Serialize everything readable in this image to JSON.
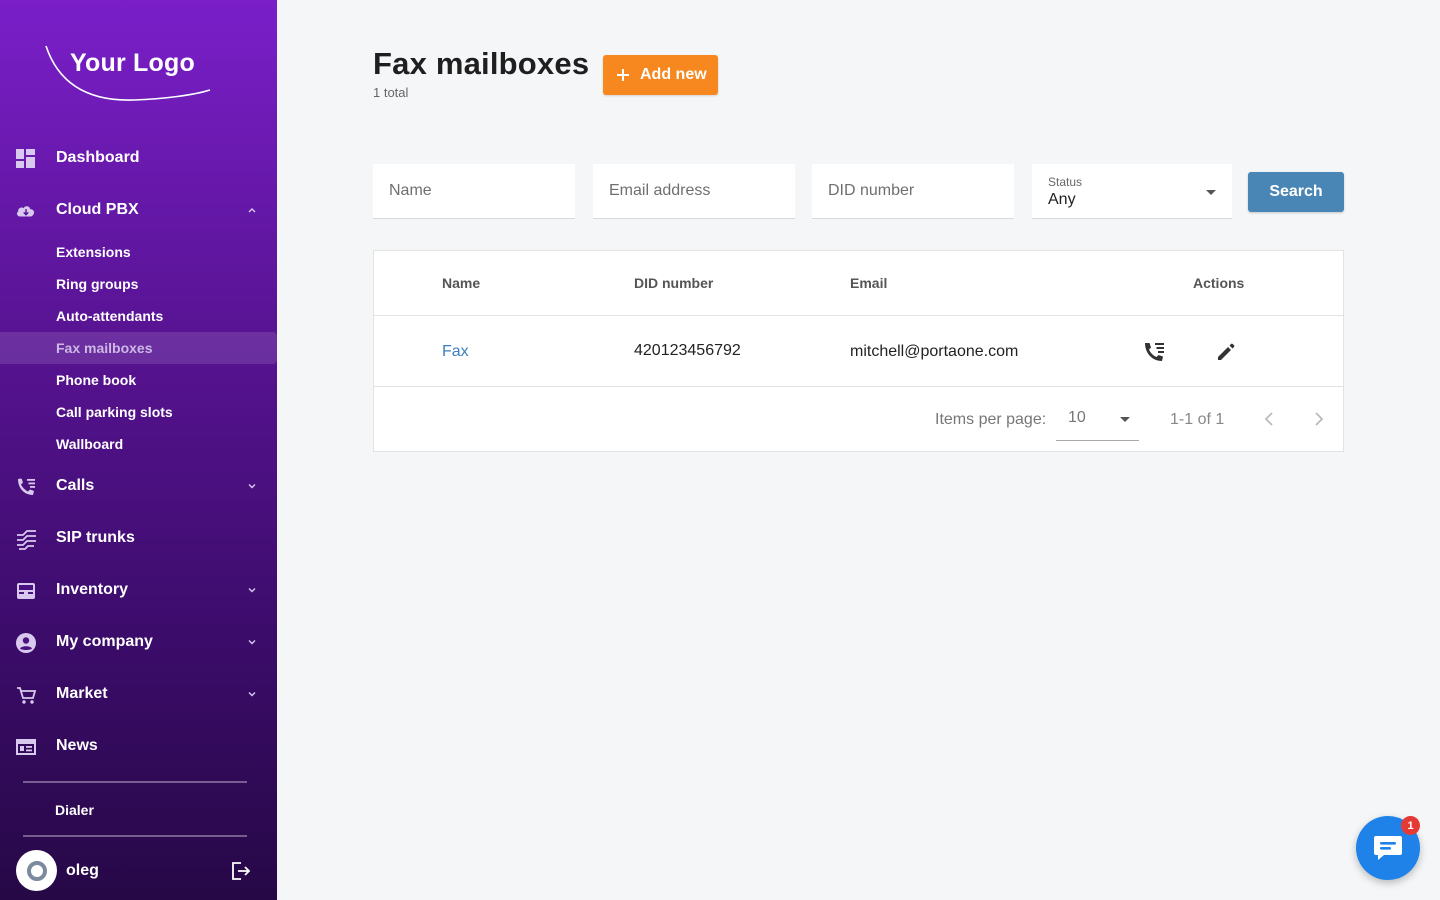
{
  "sidebar": {
    "logo_text": "Your Logo",
    "nav": {
      "dashboard": "Dashboard",
      "cloud_pbx": "Cloud PBX",
      "calls": "Calls",
      "sip_trunks": "SIP trunks",
      "inventory": "Inventory",
      "my_company": "My company",
      "market": "Market",
      "news": "News"
    },
    "cloud_pbx_items": {
      "extensions": "Extensions",
      "ring_groups": "Ring groups",
      "auto_attendants": "Auto-attendants",
      "fax_mailboxes": "Fax mailboxes",
      "phone_book": "Phone book",
      "call_parking_slots": "Call parking slots",
      "wallboard": "Wallboard"
    },
    "active_item": "Fax mailboxes",
    "dialer": "Dialer",
    "user": {
      "name": "oleg"
    }
  },
  "header": {
    "title": "Fax mailboxes",
    "subtitle": "1 total",
    "add_button": "Add new"
  },
  "filters": {
    "name_placeholder": "Name",
    "email_placeholder": "Email address",
    "did_placeholder": "DID number",
    "status_label": "Status",
    "status_value": "Any",
    "search_button": "Search"
  },
  "table": {
    "columns": {
      "name": "Name",
      "did": "DID number",
      "email": "Email",
      "actions": "Actions"
    },
    "rows": [
      {
        "name": "Fax",
        "did": "420123456792",
        "email": "mitchell@portaone.com"
      }
    ]
  },
  "pagination": {
    "items_per_page_label": "Items per page:",
    "items_per_page": "10",
    "range": "1-1 of 1"
  },
  "chat": {
    "badge": "1"
  },
  "colors": {
    "sidebar_top": "#7a1fc9",
    "sidebar_bottom": "#260846",
    "accent_orange": "#f7871f",
    "search_blue": "#4a86b5",
    "link_blue": "#3d7fbf",
    "chat_blue": "#1e82e8",
    "badge_red": "#e53935"
  }
}
